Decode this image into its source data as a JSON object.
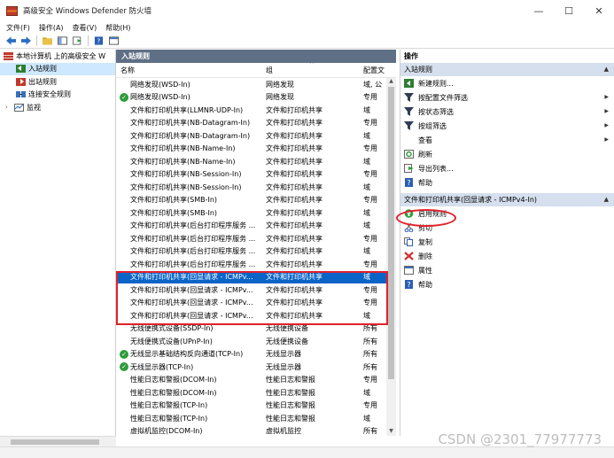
{
  "window": {
    "title": "高级安全 Windows Defender 防火墙",
    "minimize": "—",
    "maximize": "☐",
    "close": "✕"
  },
  "menu": [
    "文件(F)",
    "操作(A)",
    "查看(V)",
    "帮助(H)"
  ],
  "tree": {
    "root": "本地计算机 上的高级安全 W",
    "items": [
      "入站规则",
      "出站规则",
      "连接安全规则",
      "监视"
    ]
  },
  "center": {
    "header": "入站规则",
    "columns": {
      "name": "名称",
      "group": "组",
      "profile": "配置文"
    },
    "rows": [
      {
        "name": "网络发现(WSD-In)",
        "group": "网络发现",
        "profile": "域, 公",
        "enabled": false,
        "state": "normal"
      },
      {
        "name": "网络发现(WSD-In)",
        "group": "网络发现",
        "profile": "专用",
        "enabled": true,
        "state": "normal"
      },
      {
        "name": "文件和打印机共享(LLMNR-UDP-In)",
        "group": "文件和打印机共享",
        "profile": "域",
        "enabled": false,
        "state": "normal"
      },
      {
        "name": "文件和打印机共享(NB-Datagram-In)",
        "group": "文件和打印机共享",
        "profile": "专用",
        "enabled": false,
        "state": "normal"
      },
      {
        "name": "文件和打印机共享(NB-Datagram-In)",
        "group": "文件和打印机共享",
        "profile": "域",
        "enabled": false,
        "state": "normal"
      },
      {
        "name": "文件和打印机共享(NB-Name-In)",
        "group": "文件和打印机共享",
        "profile": "专用",
        "enabled": false,
        "state": "normal"
      },
      {
        "name": "文件和打印机共享(NB-Name-In)",
        "group": "文件和打印机共享",
        "profile": "域",
        "enabled": false,
        "state": "normal"
      },
      {
        "name": "文件和打印机共享(NB-Session-In)",
        "group": "文件和打印机共享",
        "profile": "专用",
        "enabled": false,
        "state": "normal"
      },
      {
        "name": "文件和打印机共享(NB-Session-In)",
        "group": "文件和打印机共享",
        "profile": "域",
        "enabled": false,
        "state": "normal"
      },
      {
        "name": "文件和打印机共享(SMB-In)",
        "group": "文件和打印机共享",
        "profile": "专用",
        "enabled": false,
        "state": "normal"
      },
      {
        "name": "文件和打印机共享(SMB-In)",
        "group": "文件和打印机共享",
        "profile": "域",
        "enabled": false,
        "state": "normal"
      },
      {
        "name": "文件和打印机共享(后台打印程序服务 ...",
        "group": "文件和打印机共享",
        "profile": "域",
        "enabled": false,
        "state": "normal"
      },
      {
        "name": "文件和打印机共享(后台打印程序服务 ...",
        "group": "文件和打印机共享",
        "profile": "专用",
        "enabled": false,
        "state": "normal"
      },
      {
        "name": "文件和打印机共享(后台打印程序服务 ...",
        "group": "文件和打印机共享",
        "profile": "域",
        "enabled": false,
        "state": "normal"
      },
      {
        "name": "文件和打印机共享(后台打印程序服务 ...",
        "group": "文件和打印机共享",
        "profile": "专用",
        "enabled": false,
        "state": "normal"
      },
      {
        "name": "文件和打印机共享(回显请求 - ICMPv...",
        "group": "文件和打印机共享",
        "profile": "域",
        "enabled": false,
        "state": "selected"
      },
      {
        "name": "文件和打印机共享(回显请求 - ICMPv...",
        "group": "文件和打印机共享",
        "profile": "专用",
        "enabled": false,
        "state": "normal"
      },
      {
        "name": "文件和打印机共享(回显请求 - ICMPv...",
        "group": "文件和打印机共享",
        "profile": "专用",
        "enabled": false,
        "state": "normal"
      },
      {
        "name": "文件和打印机共享(回显请求 - ICMPv...",
        "group": "文件和打印机共享",
        "profile": "域",
        "enabled": false,
        "state": "normal"
      },
      {
        "name": "无线便携式设备(SSDP-In)",
        "group": "无线便携设备",
        "profile": "所有",
        "enabled": false,
        "state": "normal"
      },
      {
        "name": "无线便携式设备(UPnP-In)",
        "group": "无线便携设备",
        "profile": "所有",
        "enabled": false,
        "state": "normal"
      },
      {
        "name": "无线显示基础结构反向通道(TCP-In)",
        "group": "无线显示器",
        "profile": "所有",
        "enabled": true,
        "state": "normal"
      },
      {
        "name": "无线显示器(TCP-In)",
        "group": "无线显示器",
        "profile": "所有",
        "enabled": true,
        "state": "normal"
      },
      {
        "name": "性能日志和警报(DCOM-In)",
        "group": "性能日志和警报",
        "profile": "专用",
        "enabled": false,
        "state": "normal"
      },
      {
        "name": "性能日志和警报(DCOM-In)",
        "group": "性能日志和警报",
        "profile": "域",
        "enabled": false,
        "state": "normal"
      },
      {
        "name": "性能日志和警报(TCP-In)",
        "group": "性能日志和警报",
        "profile": "专用",
        "enabled": false,
        "state": "normal"
      },
      {
        "name": "性能日志和警报(TCP-In)",
        "group": "性能日志和警报",
        "profile": "域",
        "enabled": false,
        "state": "normal"
      },
      {
        "name": "虚拟机监控(DCOM-In)",
        "group": "虚拟机监控",
        "profile": "所有",
        "enabled": false,
        "state": "normal"
      }
    ]
  },
  "actions": {
    "title": "操作",
    "section1": "入站规则",
    "section1_items": [
      {
        "label": "新建规则...",
        "icon": "new-rule-icon",
        "submenu": false
      },
      {
        "label": "按配置文件筛选",
        "icon": "filter-icon",
        "submenu": true
      },
      {
        "label": "按状态筛选",
        "icon": "filter-icon",
        "submenu": true
      },
      {
        "label": "按组筛选",
        "icon": "filter-icon",
        "submenu": true
      },
      {
        "label": "查看",
        "icon": "none",
        "submenu": true
      },
      {
        "label": "刷新",
        "icon": "refresh-icon",
        "submenu": false
      },
      {
        "label": "导出列表...",
        "icon": "export-icon",
        "submenu": false
      },
      {
        "label": "帮助",
        "icon": "help-icon",
        "submenu": false
      }
    ],
    "section2": "文件和打印机共享(回显请求 - ICMPv4-In)",
    "section2_items": [
      {
        "label": "启用规则",
        "icon": "enable-icon"
      },
      {
        "label": "剪切",
        "icon": "cut-icon"
      },
      {
        "label": "复制",
        "icon": "copy-icon"
      },
      {
        "label": "删除",
        "icon": "delete-icon"
      },
      {
        "label": "属性",
        "icon": "properties-icon"
      },
      {
        "label": "帮助",
        "icon": "help-icon"
      }
    ]
  },
  "watermark": "CSDN @2301_77977773",
  "colors": {
    "selection": "#0a64c8",
    "pane_header": "#5f6f85",
    "section_bg": "#d5dfed",
    "annotation_red": "#e0212b",
    "enabled_green": "#2e9c3a"
  }
}
